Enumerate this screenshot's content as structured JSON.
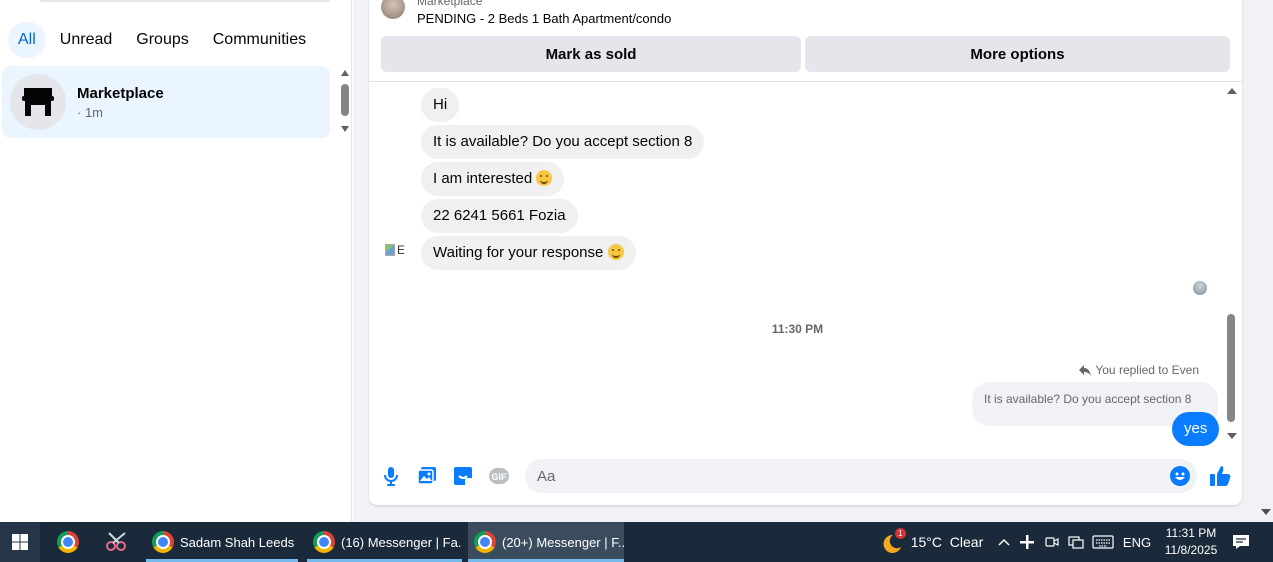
{
  "sidebar": {
    "filters": [
      "All",
      "Unread",
      "Groups",
      "Communities"
    ],
    "conversation": {
      "name": "Marketplace",
      "time": "· 1m"
    }
  },
  "chat": {
    "item_label": "Marketplace",
    "item_title": "PENDING - 2 Beds 1 Bath Apartment/condo",
    "mark_sold": "Mark as sold",
    "more_options": "More options",
    "incoming_messages": [
      "Hi",
      "It is available? Do you accept section 8",
      "I am interested",
      "22 6241 5661 Fozia",
      "Waiting for your response"
    ],
    "sender_avatar_alt": "E",
    "time_divider": "11:30 PM",
    "replied_label": "You replied to Even",
    "quoted_text": "It is available? Do you accept section 8",
    "outgoing_message": "yes",
    "composer_placeholder": "Aa",
    "icons": [
      "mic-icon",
      "photo-icon",
      "sticker-icon",
      "gif-icon",
      "emoji-icon",
      "like-icon"
    ]
  },
  "taskbar": {
    "apps": [
      "Sadam Shah Leeds ...",
      "(16) Messenger | Fa...",
      "(20+) Messenger | F..."
    ],
    "weather_badge": "1",
    "weather": "15°C  Clear",
    "language": "ENG",
    "time": "11:31 PM",
    "date": "11/8/2025"
  }
}
